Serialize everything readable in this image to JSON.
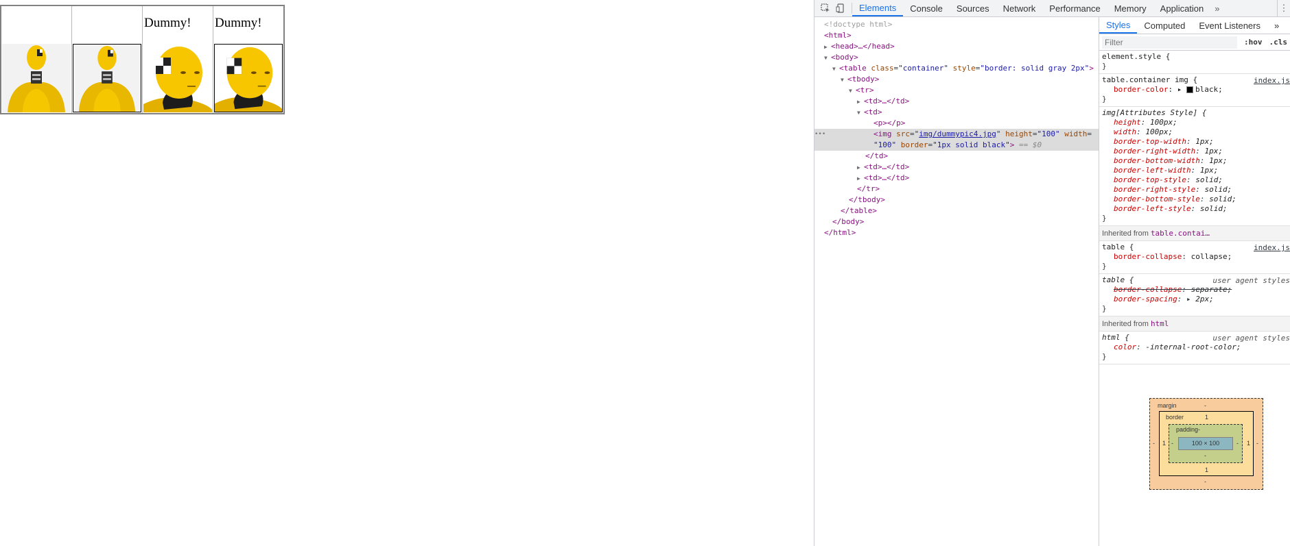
{
  "page": {
    "cells": [
      {
        "caption": "",
        "bordered": false
      },
      {
        "caption": "",
        "bordered": true
      },
      {
        "caption": "Dummy!",
        "bordered": false
      },
      {
        "caption": "Dummy!",
        "bordered": true
      }
    ]
  },
  "devtools": {
    "tabs": [
      "Elements",
      "Console",
      "Sources",
      "Network",
      "Performance",
      "Memory",
      "Application"
    ],
    "active_tab": "Elements",
    "more": "»",
    "dom": {
      "doctype": "<!doctype html>",
      "html_open": "<html>",
      "head": "<head>…</head>",
      "body_open": "<body>",
      "table_tag": "table",
      "table_class_name": "class",
      "table_class_val": "\"container\"",
      "table_style_name": "style",
      "table_style_val": "\"border: solid gray 2px\"",
      "tbody_open": "<tbody>",
      "tr_open": "<tr>",
      "td_collapsed": "<td>…</td>",
      "td_open": "<td>",
      "p_empty": "<p></p>",
      "img_src_name": "src",
      "img_src_val": "img/dummypic4.jpg",
      "img_height": "\"100\"",
      "img_width": "\"100\"",
      "img_border": "\"1px solid black\"",
      "eq_marker": "== $0",
      "td_close": "</td>",
      "tr_close": "</tr>",
      "tbody_close": "</tbody>",
      "table_close": "</table>",
      "body_close": "</body>",
      "html_close": "</html>"
    },
    "styles": {
      "tabs": [
        "Styles",
        "Computed",
        "Event Listeners"
      ],
      "active_tab": "Styles",
      "filter_placeholder": "Filter",
      "hov": ":hov",
      "cls": ".cls",
      "element_style": "element.style {",
      "rule1_selector": "table.container img {",
      "rule1_source": "index.js",
      "rule1_prop": "border-color",
      "rule1_val": "black;",
      "attr_rule_selector": "img[Attributes Style] {",
      "attr_decls": [
        {
          "p": "height",
          "v": "100px;"
        },
        {
          "p": "width",
          "v": "100px;"
        },
        {
          "p": "border-top-width",
          "v": "1px;"
        },
        {
          "p": "border-right-width",
          "v": "1px;"
        },
        {
          "p": "border-bottom-width",
          "v": "1px;"
        },
        {
          "p": "border-left-width",
          "v": "1px;"
        },
        {
          "p": "border-top-style",
          "v": "solid;"
        },
        {
          "p": "border-right-style",
          "v": "solid;"
        },
        {
          "p": "border-bottom-style",
          "v": "solid;"
        },
        {
          "p": "border-left-style",
          "v": "solid;"
        }
      ],
      "inherited1_label": "Inherited from",
      "inherited1_ref": "table.contai…",
      "table_rule_selector": "table {",
      "table_rule_source": "index.js",
      "table_rule_prop": "border-collapse",
      "table_rule_val": "collapse;",
      "ua_table_selector": "table {",
      "ua_source": "user agent styles",
      "ua_prop1": "border-collapse",
      "ua_val1": "separate;",
      "ua_prop2": "border-spacing",
      "ua_val2": "2px;",
      "inherited2_label": "Inherited from",
      "inherited2_ref": "html",
      "html_rule_selector": "html {",
      "html_prop": "color",
      "html_val": "-internal-root-color;",
      "close_brace": "}"
    },
    "box_model": {
      "margin_label": "margin",
      "margin_value": "-",
      "border_label": "border",
      "border_value": "1",
      "padding_label": "padding",
      "padding_value": "-",
      "content": "100 × 100"
    }
  }
}
